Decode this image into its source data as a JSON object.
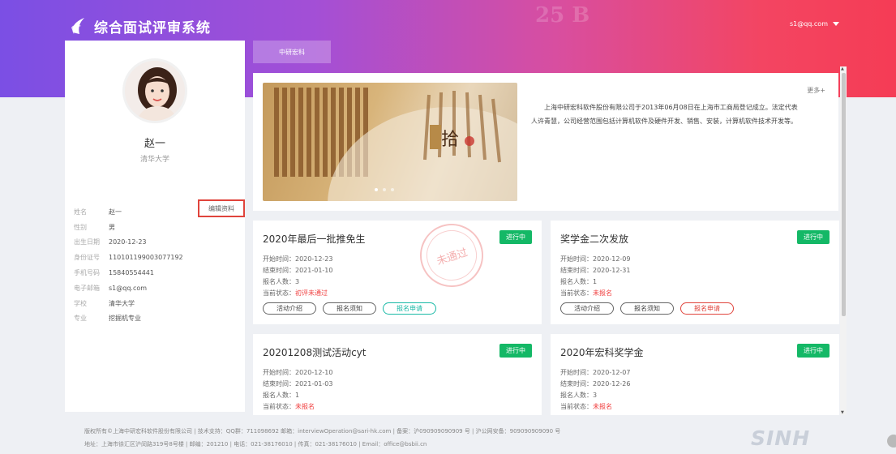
{
  "header": {
    "app_title": "综合面试评审系统",
    "user": "s1@qq.com",
    "colors": {
      "gradient_start": "#7b4fe4",
      "gradient_end": "#f53c55"
    }
  },
  "profile": {
    "name": "赵一",
    "school": "清华大学",
    "edit_label": "编辑资料",
    "fields": [
      {
        "label": "姓名",
        "value": "赵一"
      },
      {
        "label": "性别",
        "value": "男"
      },
      {
        "label": "出生日期",
        "value": "2020-12-23"
      },
      {
        "label": "身份证号",
        "value": "110101199003077192"
      },
      {
        "label": "手机号码",
        "value": "15840554441"
      },
      {
        "label": "电子邮箱",
        "value": "s1@qq.com"
      },
      {
        "label": "学校",
        "value": "清华大学"
      },
      {
        "label": "专业",
        "value": "挖掘机专业"
      }
    ]
  },
  "tab": {
    "label": "中研宏科"
  },
  "intro": {
    "more": "更多+",
    "text": "上海中研宏科软件股份有限公司于2013年06月08日在上海市工商局登记成立。法定代表人许青慧，公司经营范围包括计算机软件及硬件开发、销售、安装，计算机软件技术开发等。",
    "banner_glyph": "拾"
  },
  "cards": [
    {
      "title": "2020年最后一批推免生",
      "status": "进行中",
      "start": "开始时间：2020-12-23",
      "end": "结束时间：2021-01-10",
      "count": "报名人数：3",
      "state_label": "当前状态：",
      "state": "初评未通过",
      "stamp": "未通过",
      "buttons": [
        "活动介绍",
        "报名须知",
        "报名申请"
      ]
    },
    {
      "title": "奖学金二次发放",
      "status": "进行中",
      "start": "开始时间：2020-12-09",
      "end": "结束时间：2020-12-31",
      "count": "报名人数：1",
      "state_label": "当前状态：",
      "state": "未报名",
      "buttons": [
        "活动介绍",
        "报名须知",
        "报名申请"
      ]
    },
    {
      "title": "20201208测试活动cyt",
      "status": "进行中",
      "start": "开始时间：2020-12-10",
      "end": "结束时间：2021-01-03",
      "count": "报名人数：1",
      "state_label": "当前状态：",
      "state": "未报名"
    },
    {
      "title": "2020年宏科奖学金",
      "status": "进行中",
      "start": "开始时间：2020-12-07",
      "end": "结束时间：2020-12-26",
      "count": "报名人数：3",
      "state_label": "当前状态：",
      "state": "未报名"
    }
  ],
  "footer": {
    "line1": "版权所有©上海中研宏科软件股份有限公司 | 技术支持：QQ群：711098692 邮箱：interviewOperation@sari-hk.com | 备案：沪090909090909 号 | 沪公网安备：909090909090 号",
    "line2": "地址：上海市徐汇区沪闵路319号8号楼 | 邮编：201210 | 电话：021-38176010 | 传真：021-38176010 | Email：office@bsbii.cn",
    "brand": "SINH"
  },
  "status_color": "#14b866"
}
